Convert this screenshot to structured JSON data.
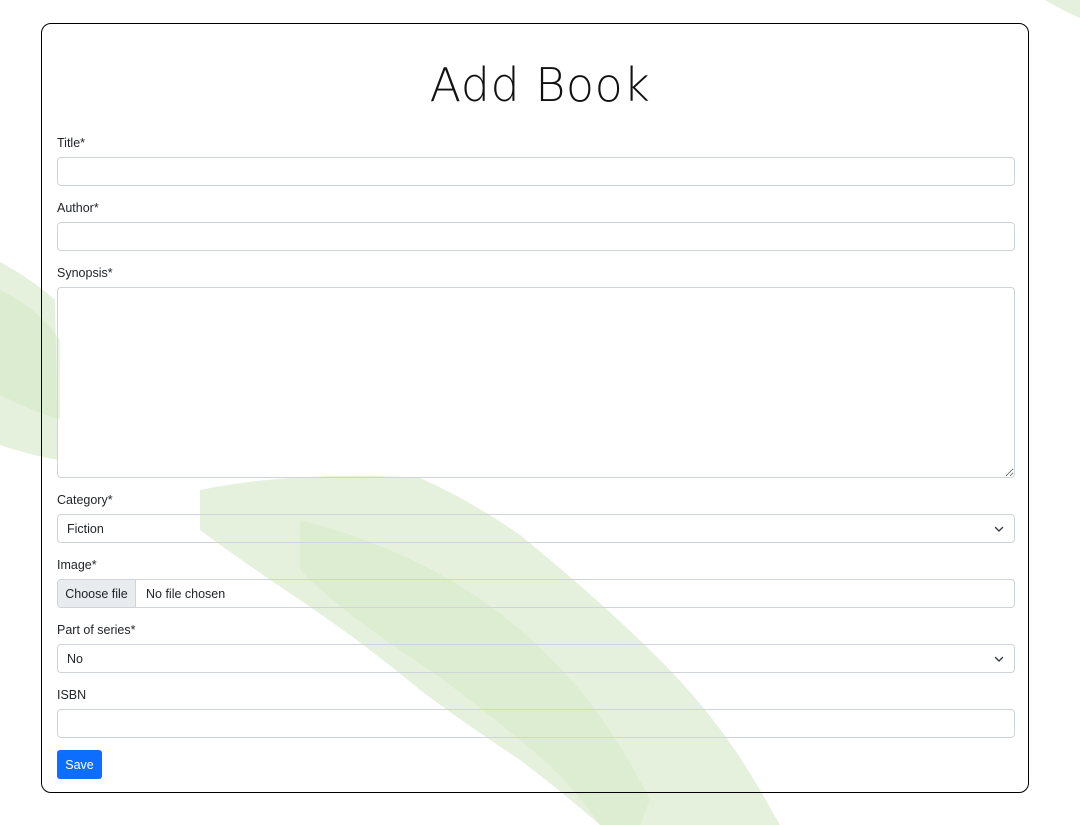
{
  "page": {
    "title": "Add Book"
  },
  "form": {
    "title_label": "Title*",
    "title_value": "",
    "author_label": "Author*",
    "author_value": "",
    "synopsis_label": "Synopsis*",
    "synopsis_value": "",
    "category_label": "Category*",
    "category_selected": "Fiction",
    "image_label": "Image*",
    "image_button_label": "Choose file",
    "image_status": "No file chosen",
    "series_label": "Part of series*",
    "series_selected": "No",
    "isbn_label": "ISBN",
    "isbn_value": "",
    "save_label": "Save"
  },
  "colors": {
    "primary": "#0d6efd",
    "border": "#ced4da",
    "file_button_bg": "#e9ecef",
    "decor_green": "#c9e2b8"
  },
  "icons": {
    "select_arrow": "chevron-down-icon"
  }
}
